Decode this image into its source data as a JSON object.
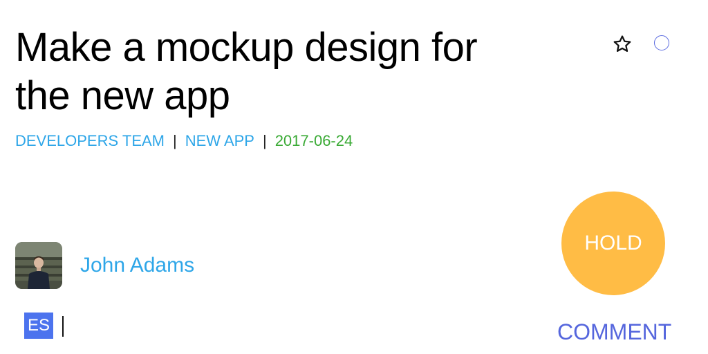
{
  "task": {
    "title": "Make a mockup design for the new app",
    "team": "DEVELOPERS TEAM",
    "project": "NEW APP",
    "date": "2017-06-24",
    "separator": "|"
  },
  "actions": {
    "favorite_icon": "star-outline-icon",
    "select_icon": "circle-outline-icon"
  },
  "assignee": {
    "name": "John Adams"
  },
  "status_button": {
    "label": "HOLD"
  },
  "composer": {
    "language_badge": "ES",
    "comment_label": "COMMENT"
  },
  "colors": {
    "link": "#2ea6e8",
    "date": "#3aaa35",
    "hold": "#ffbc45",
    "badge": "#4c73ee",
    "comment": "#5566dd"
  }
}
